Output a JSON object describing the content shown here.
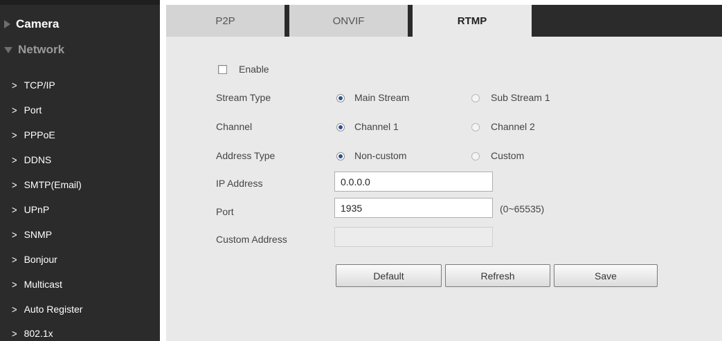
{
  "sidebar": {
    "camera": "Camera",
    "network": "Network",
    "items": [
      {
        "label": "TCP/IP"
      },
      {
        "label": "Port"
      },
      {
        "label": "PPPoE"
      },
      {
        "label": "DDNS"
      },
      {
        "label": "SMTP(Email)"
      },
      {
        "label": "UPnP"
      },
      {
        "label": "SNMP"
      },
      {
        "label": "Bonjour"
      },
      {
        "label": "Multicast"
      },
      {
        "label": "Auto Register"
      },
      {
        "label": "802.1x"
      }
    ],
    "chevron": ">"
  },
  "tabs": [
    {
      "label": "P2P",
      "active": false
    },
    {
      "label": "ONVIF",
      "active": false
    },
    {
      "label": "RTMP",
      "active": true
    }
  ],
  "form": {
    "enable_label": "Enable",
    "enable_checked": false,
    "stream_type": {
      "label": "Stream Type",
      "options": [
        "Main Stream",
        "Sub Stream 1"
      ],
      "selected": "Main Stream"
    },
    "channel": {
      "label": "Channel",
      "options": [
        "Channel 1",
        "Channel 2"
      ],
      "selected": "Channel 1"
    },
    "address_type": {
      "label": "Address Type",
      "options": [
        "Non-custom",
        "Custom"
      ],
      "selected": "Non-custom"
    },
    "ip_address": {
      "label": "IP Address",
      "value": "0.0.0.0"
    },
    "port": {
      "label": "Port",
      "value": "1935",
      "hint": "(0~65535)"
    },
    "custom_address": {
      "label": "Custom Address",
      "value": "",
      "disabled": true
    }
  },
  "buttons": {
    "default": "Default",
    "refresh": "Refresh",
    "save": "Save"
  },
  "colors": {
    "sidebar_bg": "#2b2b2b",
    "panel_bg": "#e9e9e9",
    "radio_accent": "#2d4f9a"
  }
}
